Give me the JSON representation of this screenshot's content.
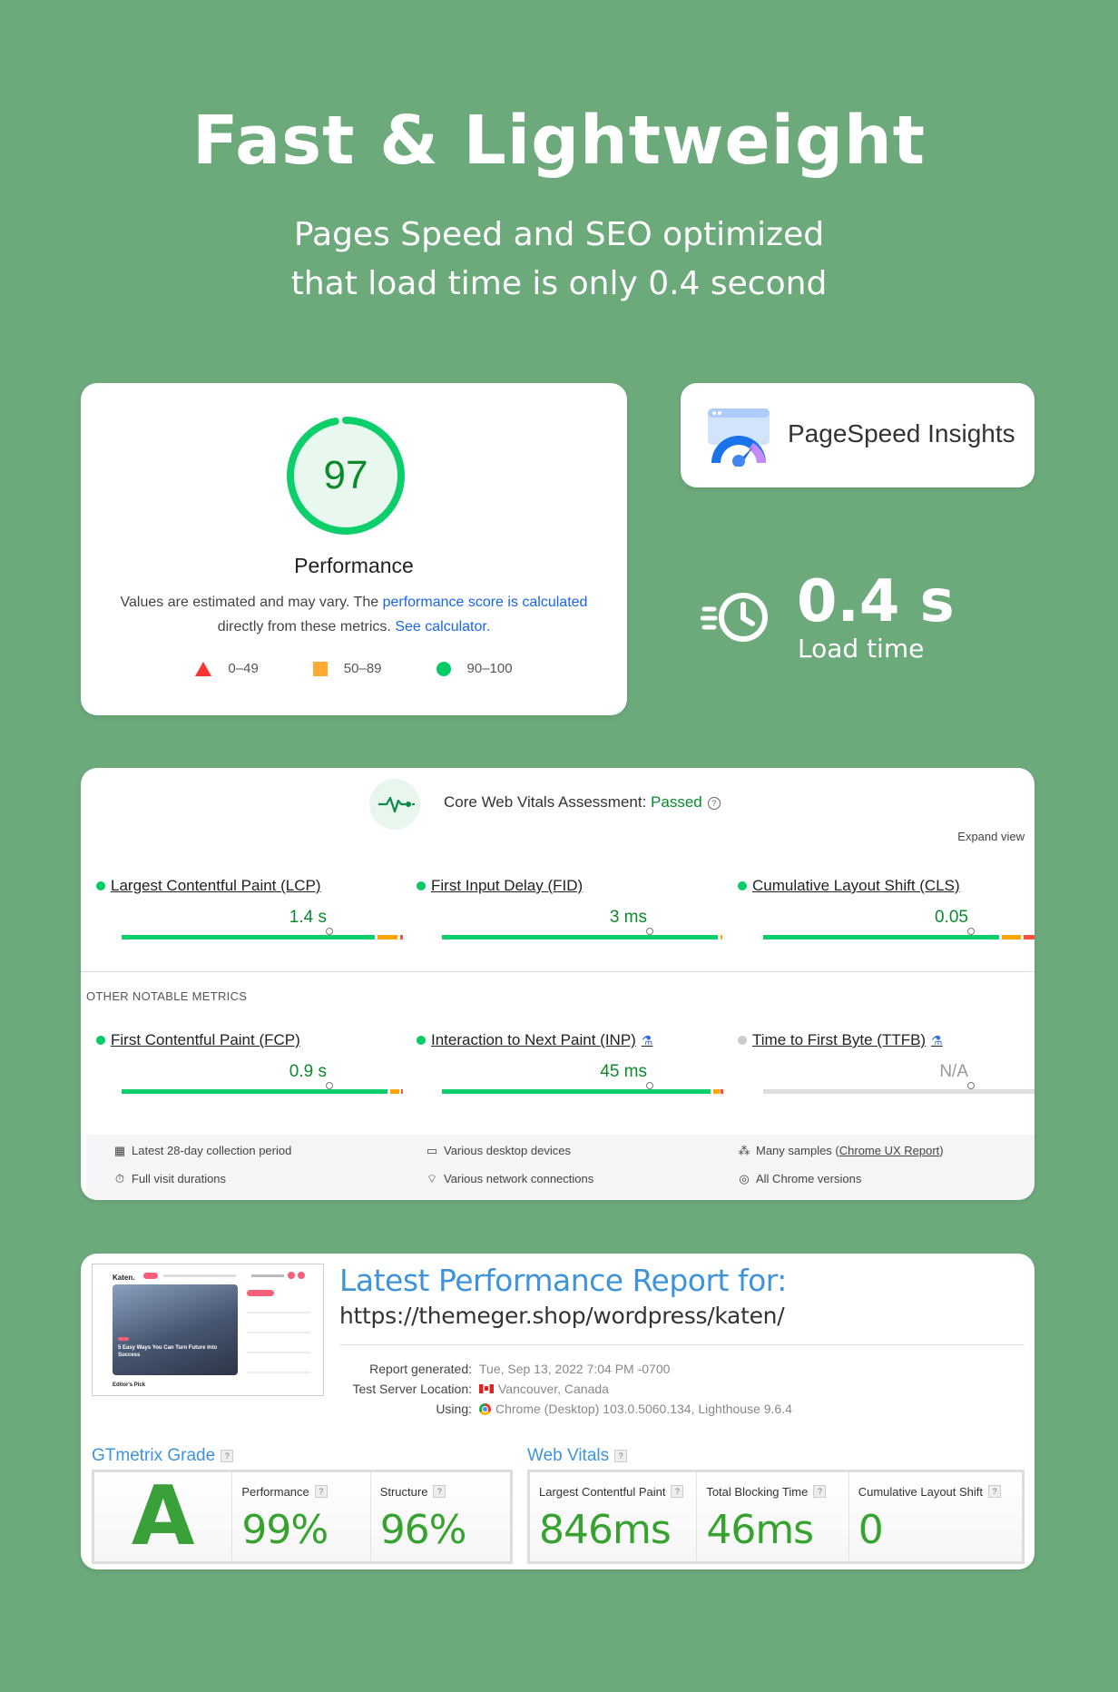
{
  "hero": {
    "title": "Fast & Lightweight",
    "subtitle_line1": "Pages Speed and SEO optimized",
    "subtitle_line2": "that load time is only 0.4 second"
  },
  "performance": {
    "score": "97",
    "score_fraction": 0.97,
    "label": "Performance",
    "note_text1": "Values are estimated and may vary. The ",
    "note_link1": "performance score is calculated",
    "note_text2": "directly from these metrics. ",
    "note_link2": "See calculator.",
    "legend": [
      {
        "shape": "triangle",
        "label": "0–49",
        "color": "#ff3333"
      },
      {
        "shape": "square",
        "label": "50–89",
        "color": "#ffaa33"
      },
      {
        "shape": "circle",
        "label": "90–100",
        "color": "#00cc66"
      }
    ]
  },
  "pagespeed": {
    "title": "PageSpeed Insights",
    "icon": "pagespeed-gauge-icon"
  },
  "load_time": {
    "value": "0.4 s",
    "label": "Load time",
    "icon": "fast-clock-icon"
  },
  "cwv": {
    "assessment_label": "Core Web Vitals Assessment: ",
    "assessment_status": "Passed",
    "expand_label": "Expand view",
    "other_label": "OTHER NOTABLE METRICS",
    "core_metrics": [
      {
        "name": "Largest Contentful Paint (LCP)",
        "value": "1.4 s"
      },
      {
        "name": "First Input Delay (FID)",
        "value": "3 ms"
      },
      {
        "name": "Cumulative Layout Shift (CLS)",
        "value": "0.05"
      }
    ],
    "other_metrics": [
      {
        "name": "First Contentful Paint (FCP)",
        "value": "0.9 s"
      },
      {
        "name": "Interaction to Next Paint (INP)",
        "value": "45 ms"
      },
      {
        "name": "Time to First Byte (TTFB)",
        "value": "N/A"
      }
    ],
    "footer": {
      "collection": "Latest 28-day collection period",
      "durations": "Full visit durations",
      "devices": "Various desktop devices",
      "network": "Various network connections",
      "samples_prefix": "Many samples (",
      "samples_link": "Chrome UX Report",
      "samples_suffix": ")",
      "versions": "All Chrome versions"
    },
    "colors": {
      "good": "#00cc66",
      "average": "#ffaa33",
      "poor": "#ff4e42"
    }
  },
  "gtmetrix": {
    "report_title": "Latest Performance Report for:",
    "url": "https://themeger.shop/wordpress/katen/",
    "meta": [
      {
        "key": "Report generated:",
        "value": "Tue, Sep 13, 2022 7:04 PM -0700"
      },
      {
        "key": "Test Server Location:",
        "value": "Vancouver, Canada"
      },
      {
        "key": "Using:",
        "value": "Chrome (Desktop) 103.0.5060.134, Lighthouse 9.6.4"
      }
    ],
    "grade_title": "GTmetrix Grade",
    "grade": "A",
    "performance_label": "Performance",
    "performance_value": "99%",
    "structure_label": "Structure",
    "structure_value": "96%",
    "vitals_title": "Web Vitals",
    "lcp_label": "Largest Contentful Paint",
    "lcp_value": "846ms",
    "tbt_label": "Total Blocking Time",
    "tbt_value": "46ms",
    "cls_label": "Cumulative Layout Shift",
    "cls_value": "0"
  },
  "thumbnail": {
    "logo": "Katen.",
    "headline": "5 Easy Ways You Can Turn Future Into Success",
    "section": "Editor's Pick"
  }
}
